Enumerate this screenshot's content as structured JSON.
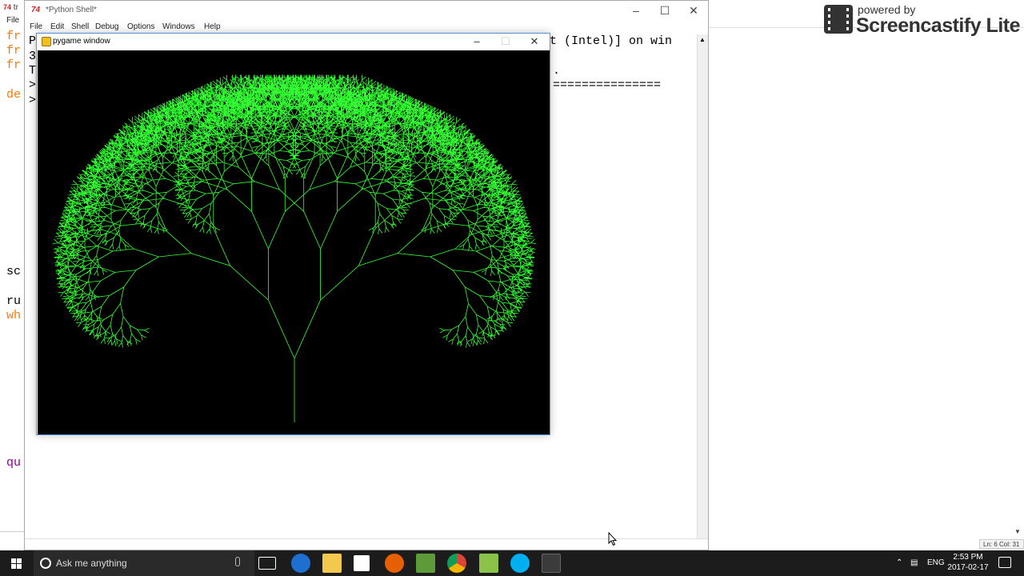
{
  "editor": {
    "title_fragment": "tr",
    "menu_fragment": "File",
    "code_fragments": [
      "fr",
      "fr",
      "fr",
      "de",
      "sc",
      "ru",
      "wh",
      "qu"
    ]
  },
  "shell": {
    "title": "*Python Shell*",
    "menu": [
      "File",
      "Edit",
      "Shell",
      "Debug",
      "Options",
      "Windows",
      "Help"
    ],
    "visible_lines": {
      "line1_start": "P",
      "line1_end": "t (Intel)] on win",
      "line2_start": "3",
      "line3_start": "T",
      "line3_end": ".",
      "line4_start": ">",
      "line4_end": "===============",
      "line5_start": ">"
    },
    "status": ""
  },
  "pygame": {
    "title": "pygame window"
  },
  "status_right": "Ln: 6  Col: 31",
  "watermark": {
    "small": "powered by",
    "big": "Screencastify Lite"
  },
  "taskbar": {
    "search_placeholder": "Ask me anything",
    "language": "ENG",
    "time": "2:53 PM",
    "date": "2017-02-17",
    "pinned": [
      "task-view",
      "edge",
      "file-explorer",
      "store",
      "firefox",
      "minecraft",
      "chrome",
      "notepad-plus",
      "skype",
      "python-idle"
    ]
  },
  "colors": {
    "tree": "#33ff33",
    "taskbar": "#1c1c1c",
    "keyword": "#ff7700",
    "builtin": "#900090"
  }
}
